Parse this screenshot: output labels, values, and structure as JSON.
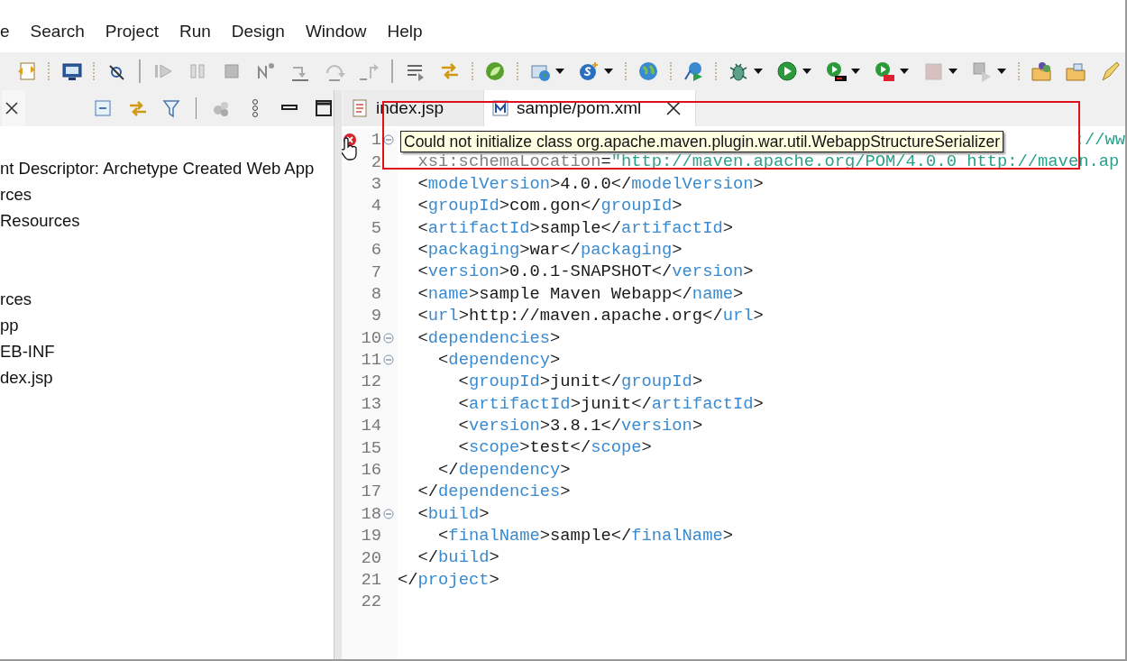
{
  "menu": [
    {
      "label": "e"
    },
    {
      "label": "Search"
    },
    {
      "label": "Project"
    },
    {
      "label": "Run"
    },
    {
      "label": "Design"
    },
    {
      "label": "Window"
    },
    {
      "label": "Help"
    }
  ],
  "explorer": {
    "groups": [
      [
        "nt Descriptor: Archetype Created Web App",
        "rces",
        "Resources"
      ],
      [
        "rces",
        "pp",
        "EB-INF",
        "dex.jsp"
      ]
    ]
  },
  "editor": {
    "tabs": [
      {
        "label": "index.jsp",
        "selected": false,
        "kind": "jsp"
      },
      {
        "label": "sample/pom.xml",
        "selected": true,
        "kind": "maven"
      }
    ],
    "tooltip": "Could not initialize class org.apache.maven.plugin.war.util.WebappStructureSerializer",
    "lines": [
      {
        "number": "1",
        "foldable": true,
        "error": true,
        "segments": [
          {
            "kind": "value",
            "text": "://ww"
          }
        ]
      },
      {
        "number": "2",
        "foldable": false,
        "error": false,
        "segments": [
          {
            "kind": "attr",
            "text": "  xsi:schemaLocation"
          },
          {
            "kind": "punct",
            "text": "="
          },
          {
            "kind": "value",
            "text": "\"http://maven.apache.org/POM/4.0.0 http://maven.ap"
          }
        ]
      },
      {
        "number": "3",
        "foldable": false,
        "error": false,
        "segments": [
          {
            "kind": "punct",
            "text": "  <"
          },
          {
            "kind": "tag",
            "text": "modelVersion"
          },
          {
            "kind": "punct",
            "text": ">4.0.0</"
          },
          {
            "kind": "tag",
            "text": "modelVersion"
          },
          {
            "kind": "punct",
            "text": ">"
          }
        ]
      },
      {
        "number": "4",
        "foldable": false,
        "error": false,
        "segments": [
          {
            "kind": "punct",
            "text": "  <"
          },
          {
            "kind": "tag",
            "text": "groupId"
          },
          {
            "kind": "punct",
            "text": ">com.gon</"
          },
          {
            "kind": "tag",
            "text": "groupId"
          },
          {
            "kind": "punct",
            "text": ">"
          }
        ]
      },
      {
        "number": "5",
        "foldable": false,
        "error": false,
        "segments": [
          {
            "kind": "punct",
            "text": "  <"
          },
          {
            "kind": "tag",
            "text": "artifactId"
          },
          {
            "kind": "punct",
            "text": ">sample</"
          },
          {
            "kind": "tag",
            "text": "artifactId"
          },
          {
            "kind": "punct",
            "text": ">"
          }
        ]
      },
      {
        "number": "6",
        "foldable": false,
        "error": false,
        "segments": [
          {
            "kind": "punct",
            "text": "  <"
          },
          {
            "kind": "tag",
            "text": "packaging"
          },
          {
            "kind": "punct",
            "text": ">war</"
          },
          {
            "kind": "tag",
            "text": "packaging"
          },
          {
            "kind": "punct",
            "text": ">"
          }
        ]
      },
      {
        "number": "7",
        "foldable": false,
        "error": false,
        "segments": [
          {
            "kind": "punct",
            "text": "  <"
          },
          {
            "kind": "tag",
            "text": "version"
          },
          {
            "kind": "punct",
            "text": ">0.0.1-SNAPSHOT</"
          },
          {
            "kind": "tag",
            "text": "version"
          },
          {
            "kind": "punct",
            "text": ">"
          }
        ]
      },
      {
        "number": "8",
        "foldable": false,
        "error": false,
        "segments": [
          {
            "kind": "punct",
            "text": "  <"
          },
          {
            "kind": "tag",
            "text": "name"
          },
          {
            "kind": "punct",
            "text": ">sample Maven Webapp</"
          },
          {
            "kind": "tag",
            "text": "name"
          },
          {
            "kind": "punct",
            "text": ">"
          }
        ]
      },
      {
        "number": "9",
        "foldable": false,
        "error": false,
        "segments": [
          {
            "kind": "punct",
            "text": "  <"
          },
          {
            "kind": "tag",
            "text": "url"
          },
          {
            "kind": "punct",
            "text": ">http://maven.apache.org</"
          },
          {
            "kind": "tag",
            "text": "url"
          },
          {
            "kind": "punct",
            "text": ">"
          }
        ]
      },
      {
        "number": "10",
        "foldable": true,
        "error": false,
        "segments": [
          {
            "kind": "punct",
            "text": "  <"
          },
          {
            "kind": "tag",
            "text": "dependencies"
          },
          {
            "kind": "punct",
            "text": ">"
          }
        ]
      },
      {
        "number": "11",
        "foldable": true,
        "error": false,
        "segments": [
          {
            "kind": "punct",
            "text": "    <"
          },
          {
            "kind": "tag",
            "text": "dependency"
          },
          {
            "kind": "punct",
            "text": ">"
          }
        ]
      },
      {
        "number": "12",
        "foldable": false,
        "error": false,
        "segments": [
          {
            "kind": "punct",
            "text": "      <"
          },
          {
            "kind": "tag",
            "text": "groupId"
          },
          {
            "kind": "punct",
            "text": ">junit</"
          },
          {
            "kind": "tag",
            "text": "groupId"
          },
          {
            "kind": "punct",
            "text": ">"
          }
        ]
      },
      {
        "number": "13",
        "foldable": false,
        "error": false,
        "segments": [
          {
            "kind": "punct",
            "text": "      <"
          },
          {
            "kind": "tag",
            "text": "artifactId"
          },
          {
            "kind": "punct",
            "text": ">junit</"
          },
          {
            "kind": "tag",
            "text": "artifactId"
          },
          {
            "kind": "punct",
            "text": ">"
          }
        ]
      },
      {
        "number": "14",
        "foldable": false,
        "error": false,
        "segments": [
          {
            "kind": "punct",
            "text": "      <"
          },
          {
            "kind": "tag",
            "text": "version"
          },
          {
            "kind": "punct",
            "text": ">3.8.1</"
          },
          {
            "kind": "tag",
            "text": "version"
          },
          {
            "kind": "punct",
            "text": ">"
          }
        ]
      },
      {
        "number": "15",
        "foldable": false,
        "error": false,
        "segments": [
          {
            "kind": "punct",
            "text": "      <"
          },
          {
            "kind": "tag",
            "text": "scope"
          },
          {
            "kind": "punct",
            "text": ">test</"
          },
          {
            "kind": "tag",
            "text": "scope"
          },
          {
            "kind": "punct",
            "text": ">"
          }
        ]
      },
      {
        "number": "16",
        "foldable": false,
        "error": false,
        "segments": [
          {
            "kind": "punct",
            "text": "    </"
          },
          {
            "kind": "tag",
            "text": "dependency"
          },
          {
            "kind": "punct",
            "text": ">"
          }
        ]
      },
      {
        "number": "17",
        "foldable": false,
        "error": false,
        "segments": [
          {
            "kind": "punct",
            "text": "  </"
          },
          {
            "kind": "tag",
            "text": "dependencies"
          },
          {
            "kind": "punct",
            "text": ">"
          }
        ]
      },
      {
        "number": "18",
        "foldable": true,
        "error": false,
        "segments": [
          {
            "kind": "punct",
            "text": "  <"
          },
          {
            "kind": "tag",
            "text": "build"
          },
          {
            "kind": "punct",
            "text": ">"
          }
        ]
      },
      {
        "number": "19",
        "foldable": false,
        "error": false,
        "segments": [
          {
            "kind": "punct",
            "text": "    <"
          },
          {
            "kind": "tag",
            "text": "finalName"
          },
          {
            "kind": "punct",
            "text": ">sample</"
          },
          {
            "kind": "tag",
            "text": "finalName"
          },
          {
            "kind": "punct",
            "text": ">"
          }
        ]
      },
      {
        "number": "20",
        "foldable": false,
        "error": false,
        "segments": [
          {
            "kind": "punct",
            "text": "  </"
          },
          {
            "kind": "tag",
            "text": "build"
          },
          {
            "kind": "punct",
            "text": ">"
          }
        ]
      },
      {
        "number": "21",
        "foldable": false,
        "error": false,
        "segments": [
          {
            "kind": "punct",
            "text": "</"
          },
          {
            "kind": "tag",
            "text": "project"
          },
          {
            "kind": "punct",
            "text": ">"
          }
        ]
      },
      {
        "number": "22",
        "foldable": false,
        "error": false
      }
    ]
  }
}
